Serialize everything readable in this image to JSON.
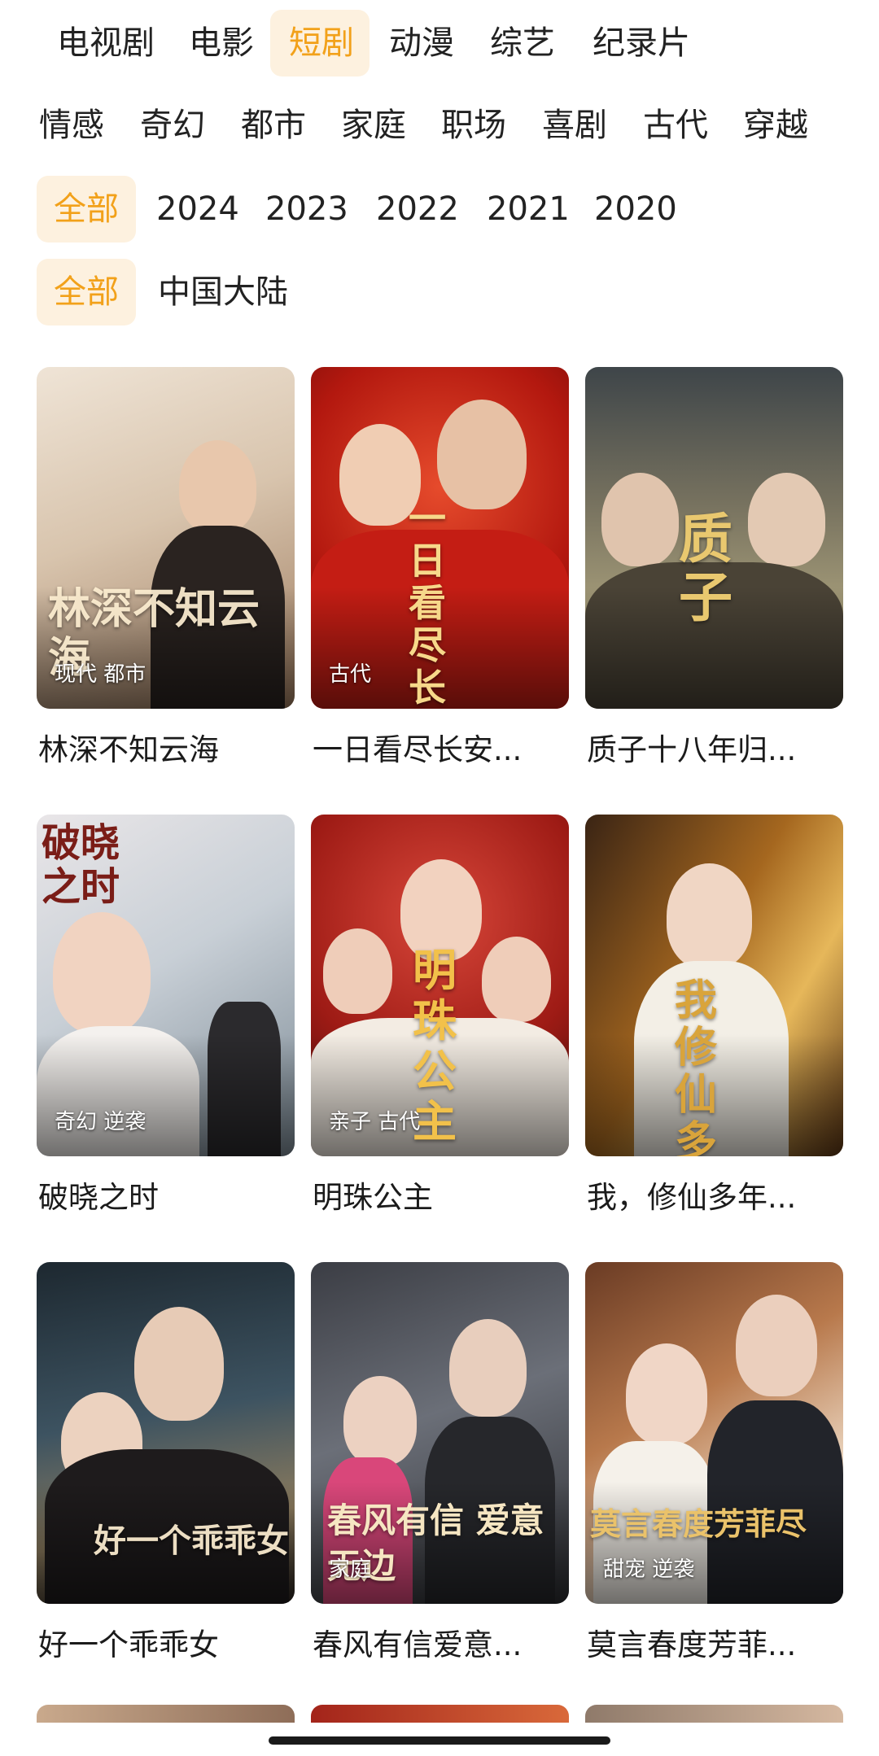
{
  "category_tabs": [
    {
      "label": "电视剧",
      "selected": false
    },
    {
      "label": "电影",
      "selected": false
    },
    {
      "label": "短剧",
      "selected": true
    },
    {
      "label": "动漫",
      "selected": false
    },
    {
      "label": "综艺",
      "selected": false
    },
    {
      "label": "纪录片",
      "selected": false
    }
  ],
  "genre_filters": [
    "情感",
    "奇幻",
    "都市",
    "家庭",
    "职场",
    "喜剧",
    "古代",
    "穿越"
  ],
  "year_filters": [
    {
      "label": "全部",
      "selected": true
    },
    {
      "label": "2024",
      "selected": false
    },
    {
      "label": "2023",
      "selected": false
    },
    {
      "label": "2022",
      "selected": false
    },
    {
      "label": "2021",
      "selected": false
    },
    {
      "label": "2020",
      "selected": false
    }
  ],
  "region_filters": [
    {
      "label": "全部",
      "selected": true
    },
    {
      "label": "中国大陆",
      "selected": false
    }
  ],
  "colors": {
    "accent": "#f2a11a",
    "accent_bg": "#fdf1df"
  },
  "items": [
    {
      "title": "林深不知云海",
      "tags": "现代 都市",
      "poster_text": "林深不知云海"
    },
    {
      "title": "一日看尽长安...",
      "tags": "古代",
      "poster_text": "一日看尽长安花"
    },
    {
      "title": "质子十八年归...",
      "tags": "",
      "poster_text": "质子"
    },
    {
      "title": "破晓之时",
      "tags": "奇幻 逆袭",
      "poster_text": "破晓之时"
    },
    {
      "title": "明珠公主",
      "tags": "亲子 古代",
      "poster_text": "明珠公主"
    },
    {
      "title": "我，修仙多年...",
      "tags": "",
      "poster_text": "我修仙多年"
    },
    {
      "title": "好一个乖乖女",
      "tags": "",
      "poster_text": "好一个乖乖女"
    },
    {
      "title": "春风有信爱意...",
      "tags": "家庭",
      "poster_text": "春风有信 爱意无边"
    },
    {
      "title": "莫言春度芳菲...",
      "tags": "甜宠 逆袭",
      "poster_text": "莫言春度芳菲尽"
    }
  ]
}
